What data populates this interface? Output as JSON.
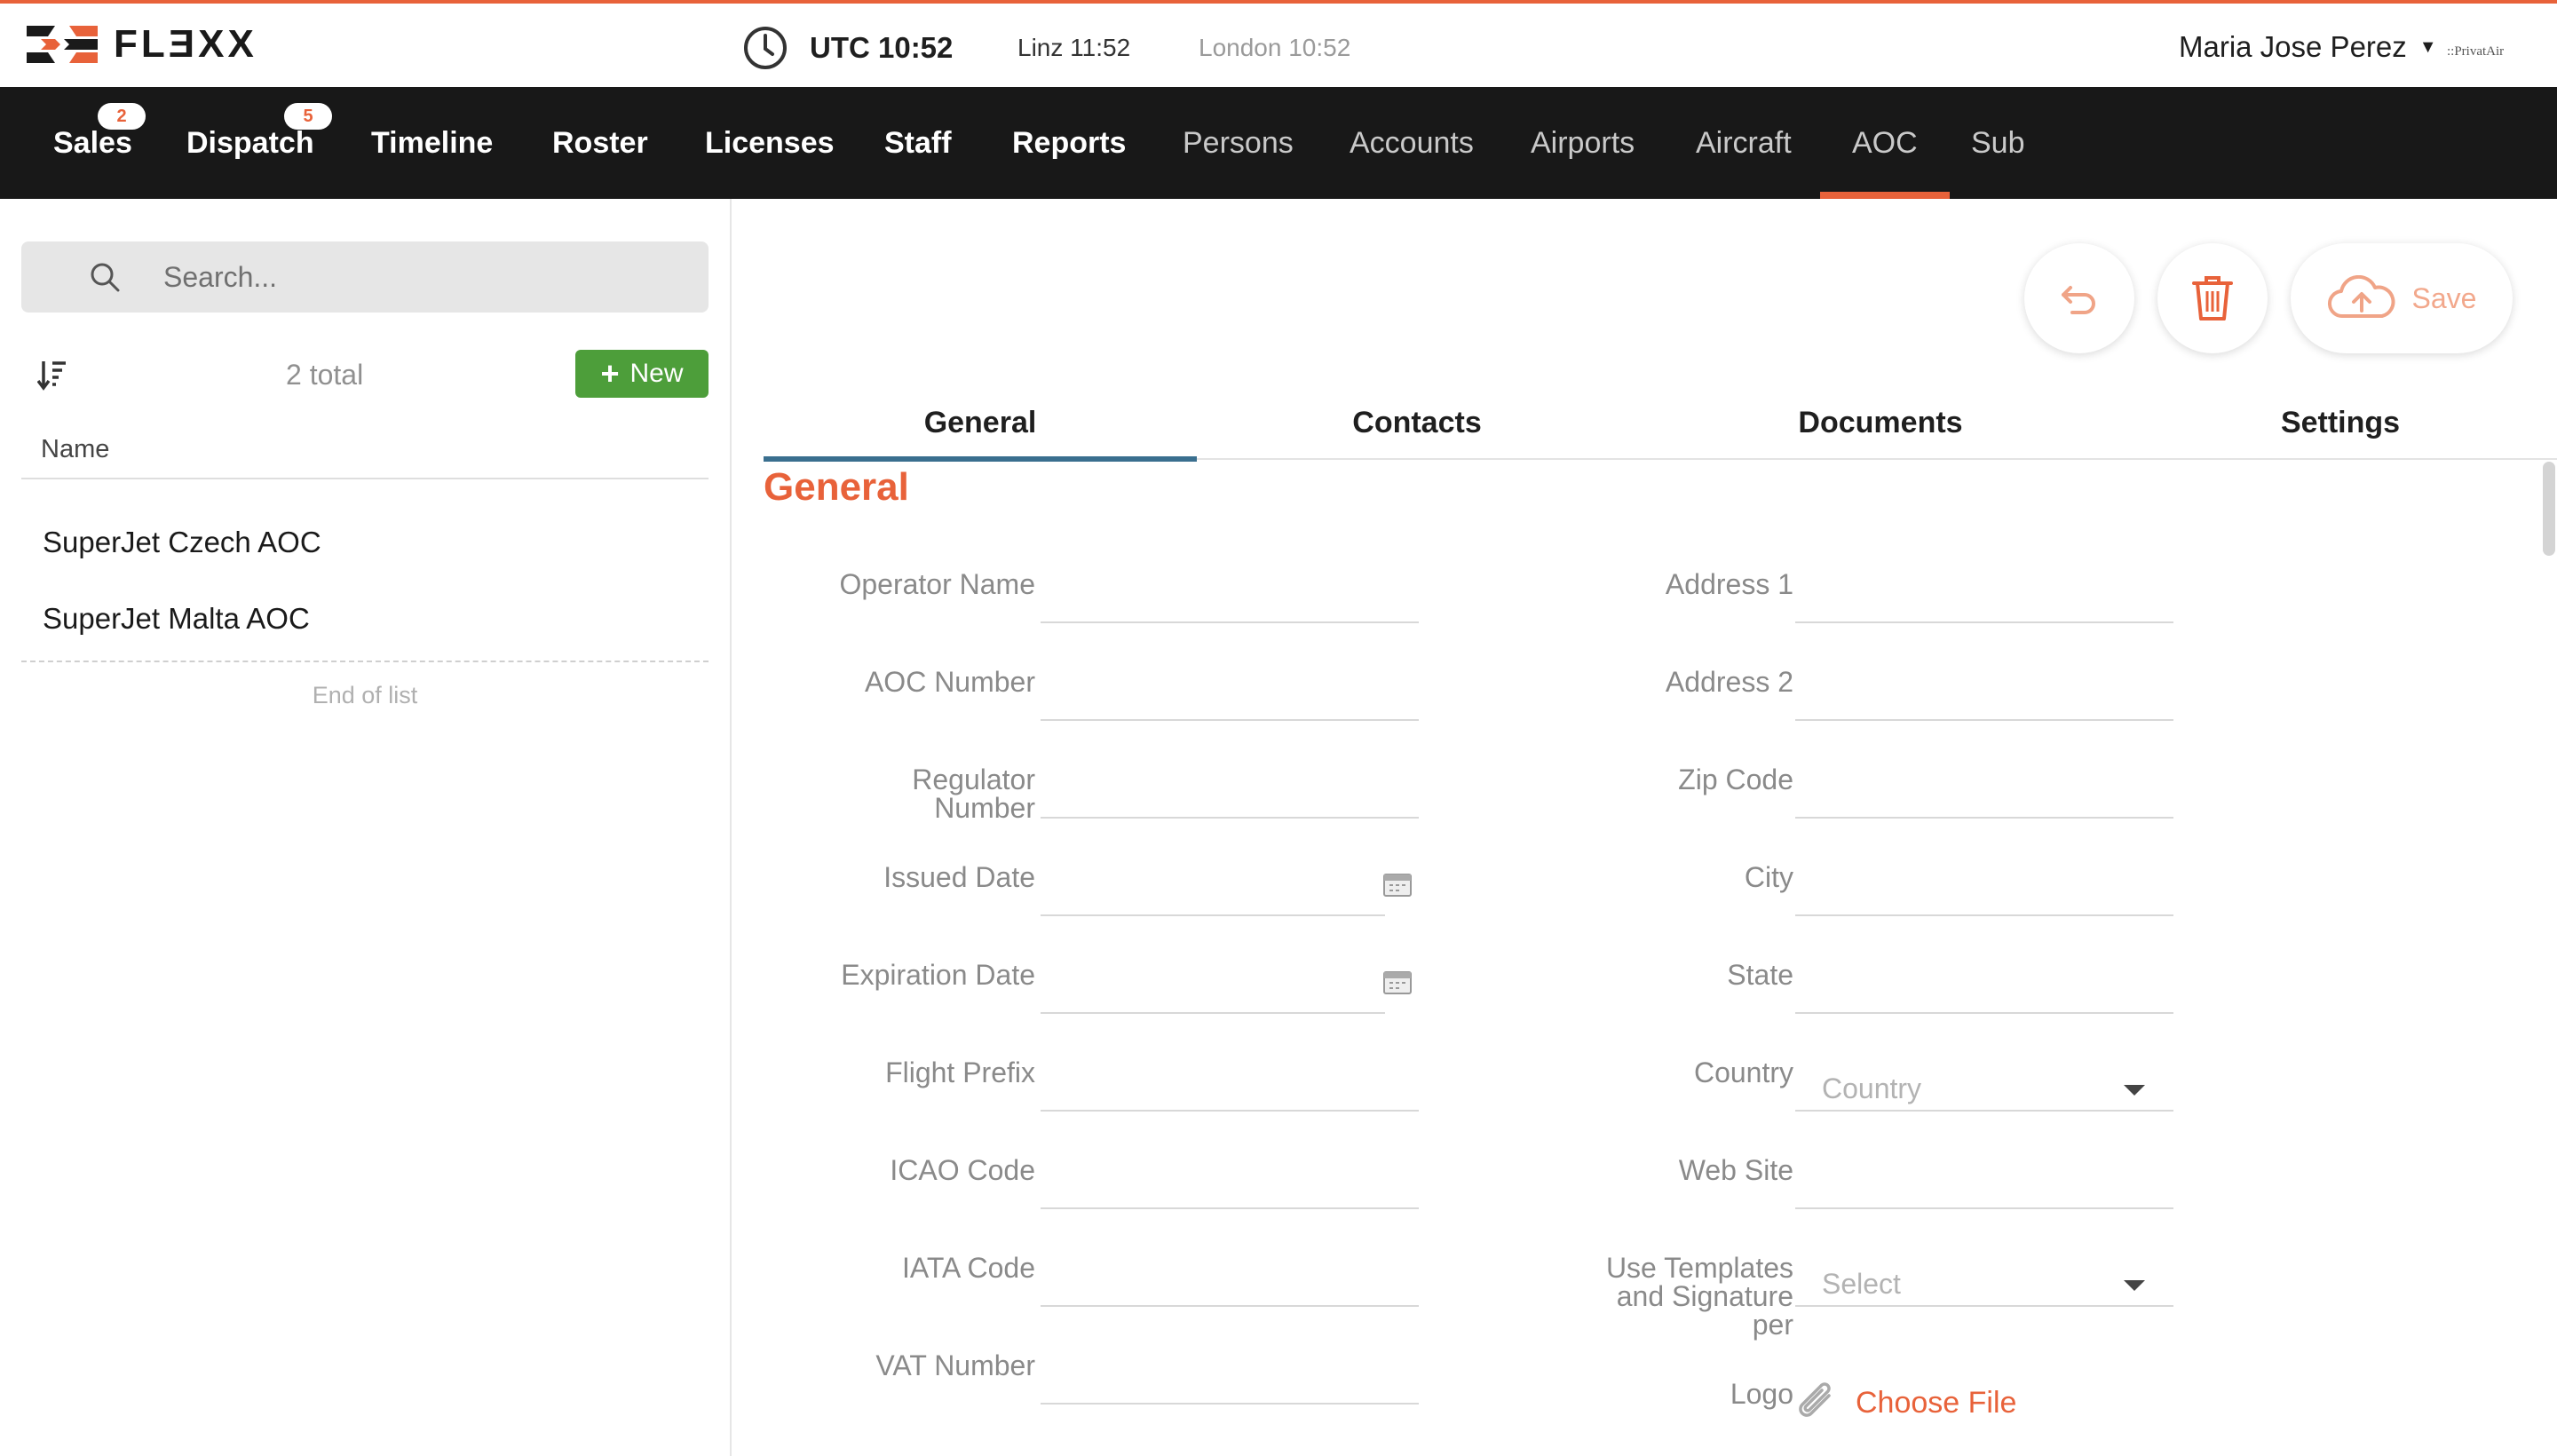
{
  "header": {
    "logo_text": "FLƎXX",
    "utc_time": "UTC 10:52",
    "tz_local": "Linz 11:52",
    "tz_other": "London 10:52",
    "user_name": "Maria Jose Perez",
    "company": "::PrivatAir"
  },
  "nav": {
    "items": [
      {
        "label": "Sales",
        "badge": "2"
      },
      {
        "label": "Dispatch",
        "badge": "5"
      },
      {
        "label": "Timeline"
      },
      {
        "label": "Roster"
      },
      {
        "label": "Licenses"
      },
      {
        "label": "Staff"
      },
      {
        "label": "Reports"
      },
      {
        "label": "Persons"
      },
      {
        "label": "Accounts"
      },
      {
        "label": "Airports"
      },
      {
        "label": "Aircraft"
      },
      {
        "label": "AOC"
      },
      {
        "label": "Sub"
      }
    ],
    "active": "AOC"
  },
  "sidebar": {
    "search_placeholder": "Search...",
    "total_text": "2 total",
    "new_label": "New",
    "column_name": "Name",
    "items": [
      "SuperJet Czech AOC",
      "SuperJet Malta AOC"
    ],
    "end_of_list": "End of list"
  },
  "toolbar": {
    "save_label": "Save"
  },
  "tabs": [
    "General",
    "Contacts",
    "Documents",
    "Settings"
  ],
  "active_tab": "General",
  "form": {
    "section_title": "General",
    "left_labels": {
      "operator_name": "Operator Name",
      "aoc_number": "AOC Number",
      "regulator_number_line1": "Regulator",
      "regulator_number_line2": "Number",
      "issued_date": "Issued Date",
      "expiration_date": "Expiration Date",
      "flight_prefix": "Flight Prefix",
      "icao_code": "ICAO Code",
      "iata_code": "IATA Code",
      "vat_number": "VAT Number"
    },
    "right_labels": {
      "address1": "Address 1",
      "address2": "Address 2",
      "zip_code": "Zip Code",
      "city": "City",
      "state": "State",
      "country": "Country",
      "web_site": "Web Site",
      "use_templates_line1": "Use Templates",
      "use_templates_line2": "and Signature",
      "use_templates_line3": "per",
      "logo": "Logo"
    },
    "country_placeholder": "Country",
    "templates_placeholder": "Select",
    "choose_file": "Choose File"
  },
  "colors": {
    "accent": "#e8623a",
    "nav_bg": "#181818",
    "new_button": "#4d9e3a",
    "tab_underline": "#3a6f8f"
  }
}
